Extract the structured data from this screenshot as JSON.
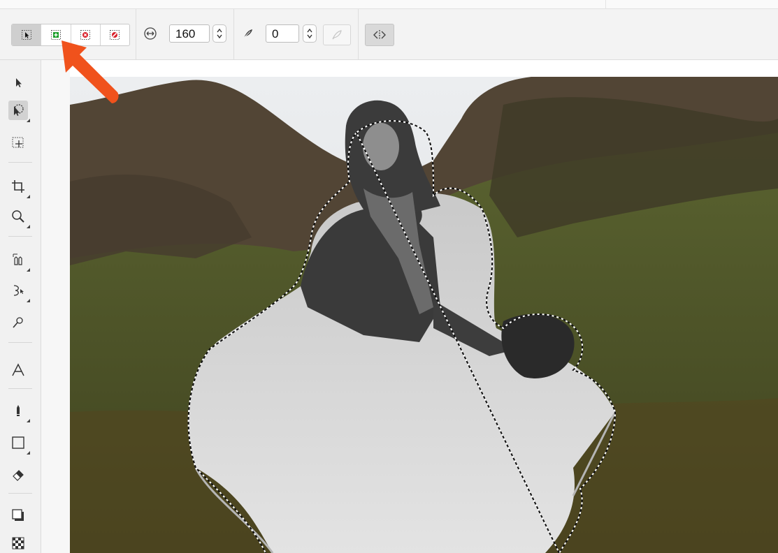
{
  "options": {
    "mode_buttons": [
      {
        "name": "new-selection",
        "active": true
      },
      {
        "name": "add-to-selection",
        "active": false
      },
      {
        "name": "subtract-from-selection",
        "active": false
      },
      {
        "name": "intersect-selection",
        "active": false
      }
    ],
    "brush_width": {
      "icon": "width-arrows-icon",
      "value": "160"
    },
    "feather": {
      "icon": "feather-icon",
      "value": "0"
    },
    "extra_buttons": [
      "feather-disabled-icon",
      "flip-selection-icon"
    ]
  },
  "tools": [
    "pick-tool-icon",
    "smart-selection-tool-icon",
    "rectangle-mask-tool-icon",
    "crop-tool-icon",
    "zoom-tool-icon",
    "eyedropper-tool-icon",
    "shape-edit-tool-icon",
    "brush-retouch-tool-icon",
    "text-tool-icon",
    "paint-brush-tool-icon",
    "rectangle-tool-icon",
    "eraser-tool-icon",
    "drop-shadow-tool-icon",
    "transparency-tool-icon"
  ],
  "canvas": {
    "description_colors": {
      "sky": "#e9eaec",
      "mountain": "#4f4232",
      "grass": "#4d5a26",
      "selection": "#ffffff"
    }
  },
  "annotation": {
    "arrow_color": "#f0521c"
  }
}
